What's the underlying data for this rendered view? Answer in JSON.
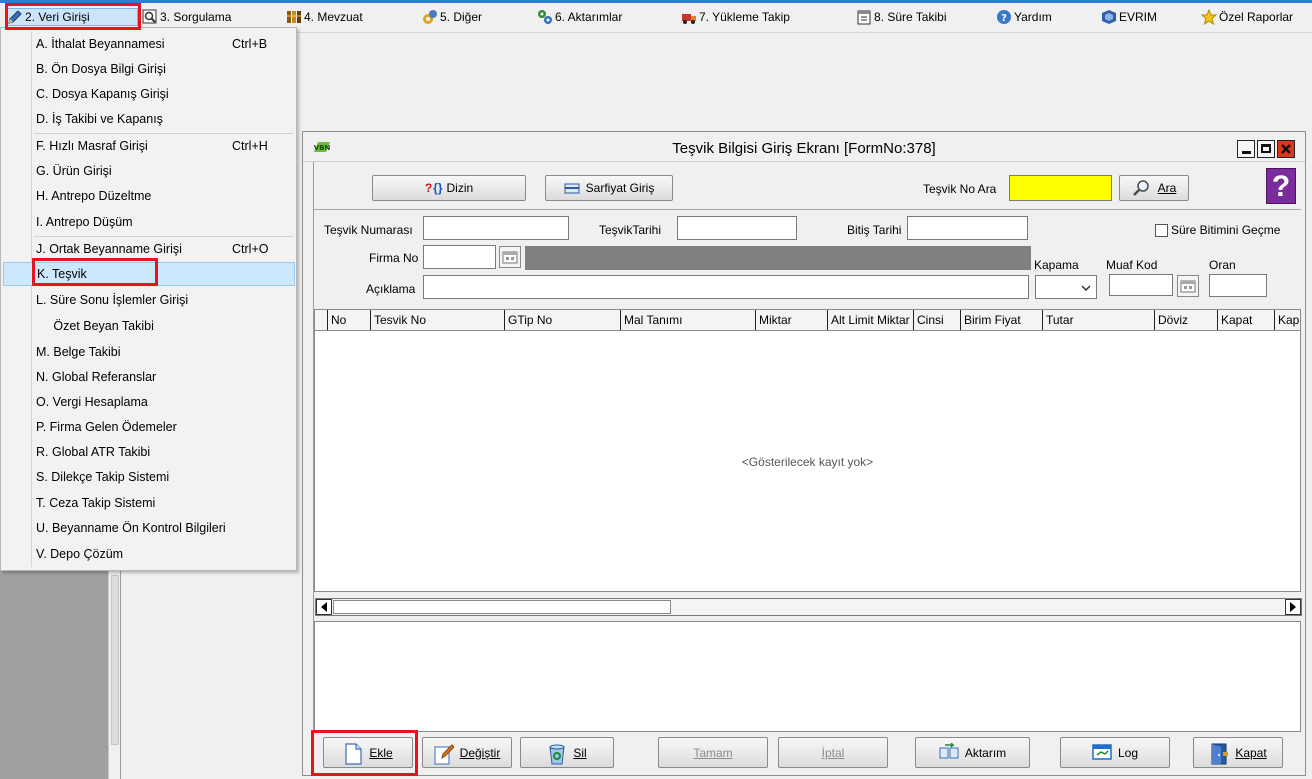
{
  "menubar": {
    "items": [
      {
        "label": "2.  Veri Girişi",
        "icon": "pencil-icon"
      },
      {
        "label": "3.  Sorgulama",
        "icon": "magnifier-icon"
      },
      {
        "label": "4.  Mevzuat",
        "icon": "books-icon"
      },
      {
        "label": "5.  Diğer",
        "icon": "tools-icon"
      },
      {
        "label": "6.  Aktarımlar",
        "icon": "gears-icon"
      },
      {
        "label": "7.  Yükleme Takip",
        "icon": "truck-icon"
      },
      {
        "label": "8. Süre Takibi",
        "icon": "calendar-icon"
      },
      {
        "label": "Yardım",
        "icon": "help-icon"
      },
      {
        "label": "EVRIM",
        "icon": "evrim-icon"
      },
      {
        "label": "Özel Raporlar",
        "icon": "star-icon"
      }
    ]
  },
  "dropdown": {
    "items": [
      {
        "label": "A.  İthalat Beyannamesi",
        "shortcut": "Ctrl+B"
      },
      {
        "label": "B.  Ön Dosya Bilgi Girişi",
        "shortcut": ""
      },
      {
        "label": "C.  Dosya Kapanış Girişi",
        "shortcut": ""
      },
      {
        "label": "D.  İş Takibi ve Kapanış",
        "shortcut": ""
      },
      {
        "label": "F.  Hızlı Masraf Girişi",
        "shortcut": "Ctrl+H"
      },
      {
        "label": "G.  Ürün Girişi",
        "shortcut": ""
      },
      {
        "label": "H.  Antrepo Düzeltme",
        "shortcut": ""
      },
      {
        "label": "I.  Antrepo Düşüm",
        "shortcut": ""
      },
      {
        "label": "J.  Ortak Beyanname Girişi",
        "shortcut": "Ctrl+O"
      },
      {
        "label": "K.  Teşvik",
        "shortcut": ""
      },
      {
        "label": "L.  Süre Sonu İşlemler Girişi",
        "shortcut": ""
      },
      {
        "label": "     Özet Beyan Takibi",
        "shortcut": ""
      },
      {
        "label": "M.  Belge Takibi",
        "shortcut": ""
      },
      {
        "label": "N. Global Referanslar",
        "shortcut": ""
      },
      {
        "label": "O. Vergi Hesaplama",
        "shortcut": ""
      },
      {
        "label": "P. Firma Gelen Ödemeler",
        "shortcut": ""
      },
      {
        "label": "R. Global ATR Takibi",
        "shortcut": ""
      },
      {
        "label": "S. Dilekçe Takip Sistemi",
        "shortcut": ""
      },
      {
        "label": "T. Ceza Takip Sistemi",
        "shortcut": ""
      },
      {
        "label": "U. Beyanname Ön Kontrol Bilgileri",
        "shortcut": ""
      },
      {
        "label": "V. Depo Çözüm",
        "shortcut": ""
      }
    ]
  },
  "window": {
    "title": "Teşvik Bilgisi Giriş Ekranı [FormNo:378]",
    "toolbar": {
      "dizin_label": "Dizin",
      "sarfiyat_label": "Sarfiyat Giriş",
      "search_label": "Teşvik No Ara",
      "search_value": "",
      "ara_label": "Ara"
    },
    "form": {
      "tesvik_no_label": "Teşvik Numarası",
      "tesvik_no_value": "",
      "tesvik_tarihi_label": "TeşvikTarihi",
      "tesvik_tarihi_value": "",
      "bitis_tarihi_label": "Bitiş Tarihi",
      "bitis_tarihi_value": "",
      "sure_checkbox_label": "Süre Bitimini Geçme",
      "sure_checkbox_checked": false,
      "firma_no_label": "Firma No",
      "firma_no_value": "",
      "aciklama_label": "Açıklama",
      "aciklama_value": "",
      "kapama_label": "Kapama",
      "kapama_value": "",
      "muaf_kod_label": "Muaf Kod",
      "muaf_kod_value": "",
      "oran_label": "Oran",
      "oran_value": ""
    },
    "grid": {
      "columns": [
        "No",
        "Tesvik No",
        "GTip No",
        "Mal Tanımı",
        "Miktar",
        "Alt Limit Miktar",
        "Cinsi",
        "Birim Fiyat",
        "Tutar",
        "Döviz",
        "Kapat",
        "Kapa"
      ],
      "empty_text": "<Gösterilecek kayıt yok>"
    },
    "buttons": {
      "ekle": "Ekle",
      "degistir": "Değiştir",
      "sil": "Sil",
      "tamam": "Tamam",
      "iptal": "İptal",
      "aktarim": "Aktarım",
      "log": "Log",
      "kapat": "Kapat"
    }
  },
  "colors": {
    "highlight_box": "#e8141b",
    "search_field": "#ffff00",
    "menu_highlight": "#cce8ff",
    "help_icon": "#7b2c9c"
  }
}
